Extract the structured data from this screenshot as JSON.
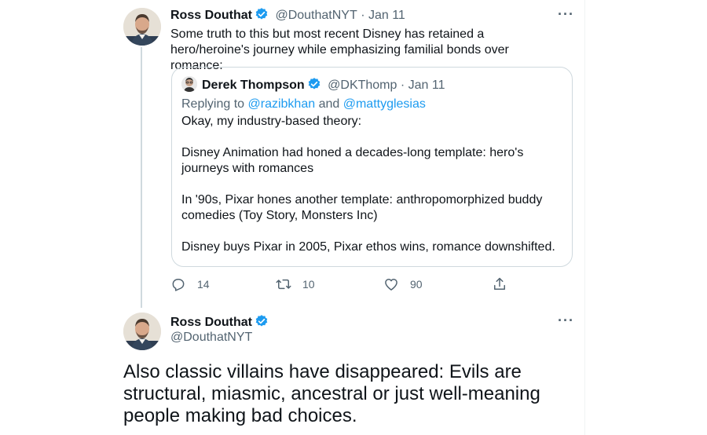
{
  "tweet1": {
    "author_name": "Ross Douthat",
    "handle": "@DouthatNYT",
    "date": "· Jan 11",
    "text": "Some truth to this but most recent Disney has retained a hero/heroine's journey while emphasizing familial bonds over romance:",
    "more_label": "···",
    "quote": {
      "author_name": "Derek Thompson",
      "handle": "@DKThomp",
      "date": "· Jan 11",
      "replying_prefix": "Replying to ",
      "replying_user1": "@razibkhan",
      "replying_and": " and ",
      "replying_user2": "@mattyglesias",
      "paragraphs": [
        "Okay, my industry-based theory:",
        "Disney Animation had honed a decades-long template: hero's journeys with romances",
        "In '90s, Pixar hones another template: anthropomorphized buddy comedies (Toy Story, Monsters Inc)",
        "Disney buys Pixar in 2005, Pixar ethos wins, romance downshifted."
      ]
    },
    "actions": {
      "replies": "14",
      "retweets": "10",
      "likes": "90",
      "icons": [
        "reply-icon",
        "retweet-icon",
        "like-icon",
        "share-icon"
      ]
    }
  },
  "tweet2": {
    "author_name": "Ross Douthat",
    "handle": "@DouthatNYT",
    "more_label": "···",
    "text": "Also classic villains have disappeared: Evils are structural, miasmic, ancestral or just well-meaning people making bad choices."
  },
  "colors": {
    "verified": "#1d9bf0",
    "muted": "#536471",
    "border": "#cfd9de",
    "text": "#0f1419"
  }
}
